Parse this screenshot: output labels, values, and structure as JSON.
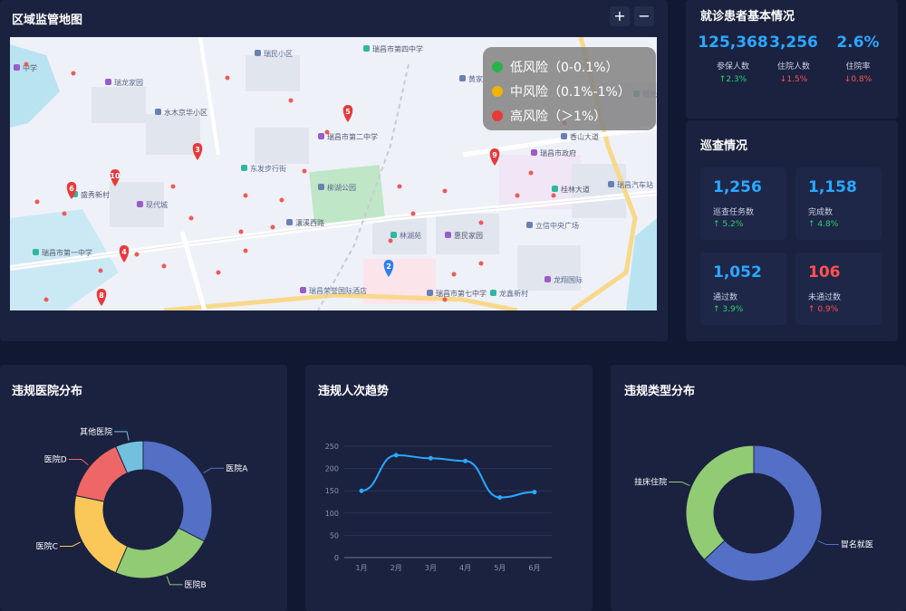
{
  "map_panel": {
    "title": "区域监管地图",
    "zoom_in": "+",
    "zoom_out": "−"
  },
  "map": {
    "labels": [
      "瑞民小区",
      "瑞昌市第四中学",
      "瑞龙家园",
      "水木京华小区",
      "东发步行街",
      "瑞昌市第二中学",
      "柳湖公园",
      "盛秀新村",
      "现代城",
      "瀼溪西路",
      "林湖苑",
      "惠民家园",
      "立信中央广场",
      "瑞昌市第一中学",
      "瑞昌荣誉国际酒店",
      "瑞昌市第七中学",
      "龙鑫新村",
      "瑞昌市政府",
      "瑞昌汽车站",
      "桂林大道",
      "龙翔国际",
      "香山大道",
      "阳光",
      "中学",
      "黄家"
    ],
    "markers": [
      "5",
      "3",
      "10",
      "6",
      "4",
      "8",
      "9",
      "2"
    ]
  },
  "legend": [
    {
      "label": "低风险（0-0.1%）",
      "color": "#2ab34a"
    },
    {
      "label": "中风险（0.1%-1%）",
      "color": "#f0b400"
    },
    {
      "label": "高风险（＞1%）",
      "color": "#e83a3a"
    }
  ],
  "patients": {
    "title": "就诊患者基本情况",
    "stats": [
      {
        "value": "125,368",
        "label": "参保人数",
        "change": "2.3%",
        "dir": "up"
      },
      {
        "value": "3,256",
        "label": "住院人数",
        "change": "1.5%",
        "dir": "down"
      },
      {
        "value": "2.6%",
        "label": "住院率",
        "change": "0.8%",
        "dir": "down"
      }
    ]
  },
  "inspection": {
    "title": "巡查情况",
    "cards": [
      {
        "value": "1,256",
        "label": "巡查任务数",
        "change": "5.2%",
        "dir": "up",
        "color": "#2aa8ff"
      },
      {
        "value": "1,158",
        "label": "完成数",
        "change": "4.8%",
        "dir": "up",
        "color": "#2aa8ff"
      },
      {
        "value": "1,052",
        "label": "通过数",
        "change": "3.9%",
        "dir": "up",
        "color": "#2aa8ff"
      },
      {
        "value": "106",
        "label": "未通过数",
        "change": "0.9%",
        "dir": "up",
        "color": "#ff5151"
      }
    ]
  },
  "icons": {
    "up": "↑",
    "down": "↓"
  },
  "chart_data": [
    {
      "type": "pie",
      "title": "违规医院分布",
      "categories": [
        "医院A",
        "医院B",
        "医院C",
        "医院D",
        "其他医院"
      ],
      "values": [
        30,
        22,
        20,
        14,
        6
      ],
      "colors": [
        "#5470c6",
        "#91cc75",
        "#fac858",
        "#ee6666",
        "#73c0de"
      ]
    },
    {
      "type": "line",
      "title": "违规人次趋势",
      "categories": [
        "1月",
        "2月",
        "3月",
        "4月",
        "5月",
        "6月"
      ],
      "values": [
        150,
        230,
        223,
        217,
        135,
        147
      ],
      "ylim": [
        0,
        250
      ],
      "yticks": [
        0,
        50,
        100,
        150,
        200,
        250
      ],
      "grid": true,
      "color": "#2aa8ff"
    },
    {
      "type": "pie",
      "title": "违规类型分布",
      "categories": [
        "冒名就医",
        "挂床住院"
      ],
      "values": [
        63,
        37
      ],
      "colors": [
        "#5470c6",
        "#91cc75"
      ]
    }
  ]
}
